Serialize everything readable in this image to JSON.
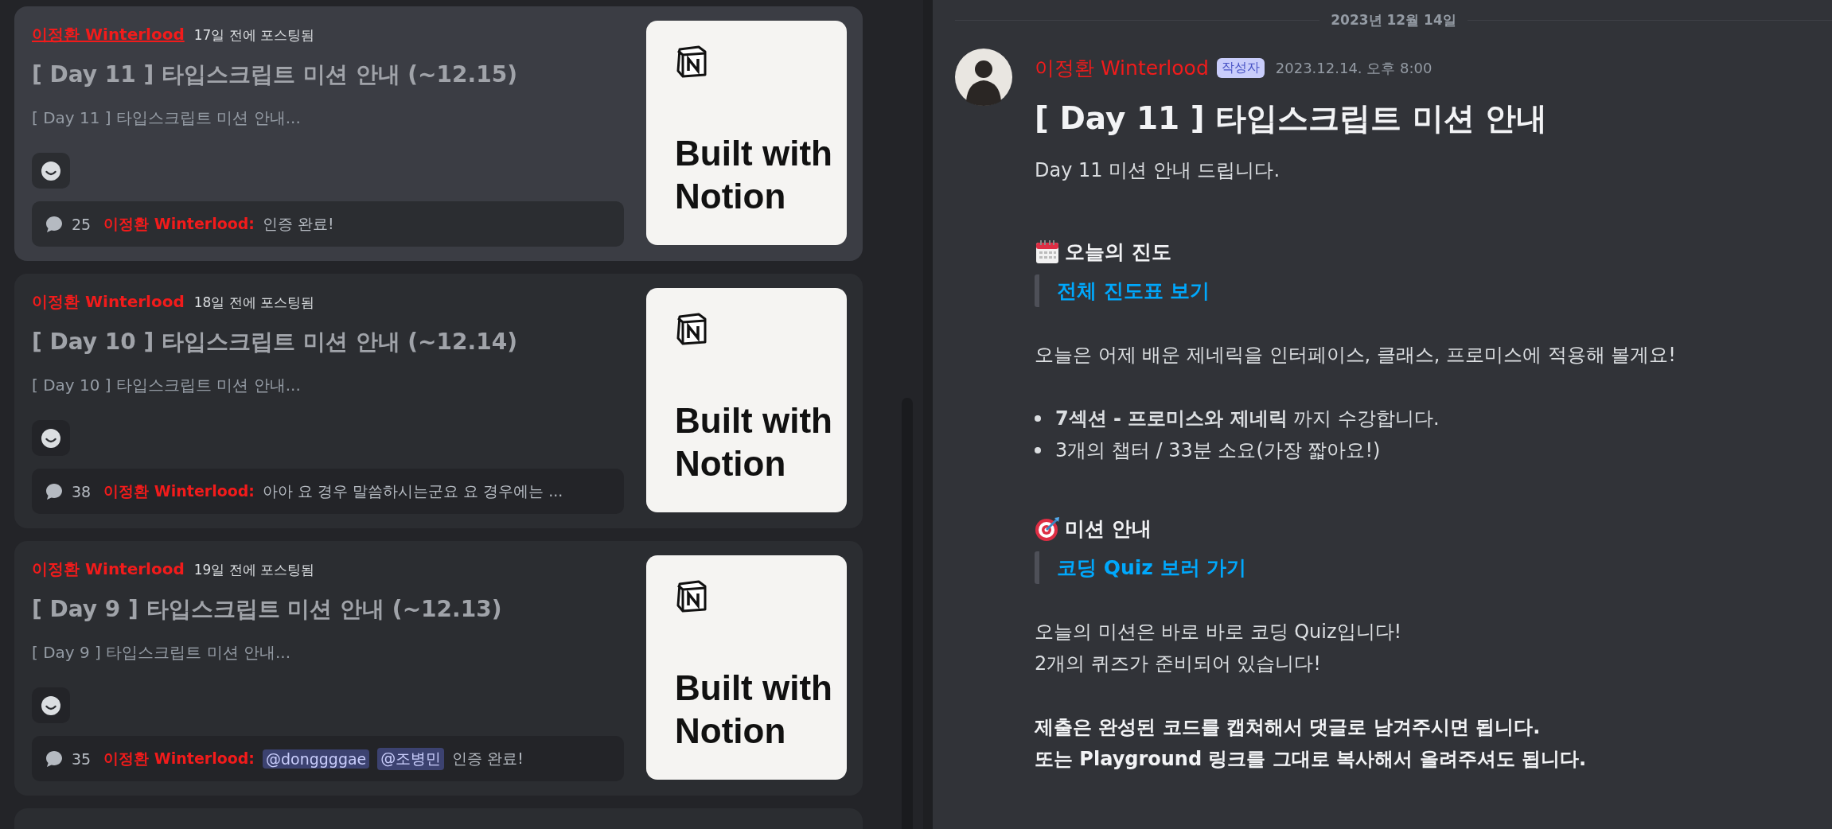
{
  "posts": [
    {
      "author": "이정환 Winterlood",
      "posted": "17일 전에 포스팅됨",
      "title": "[ Day 11 ] 타입스크립트 미션 안내 (~12.15)",
      "preview": "[ Day 11 ] 타입스크립트 미션 안내...",
      "selected": true,
      "comment_count": "25",
      "last_author": "이정환 Winterlood:",
      "last_message": [
        {
          "kind": "text",
          "text": "인증 완료!"
        }
      ],
      "thumbnail": [
        "Built with",
        "Notion"
      ]
    },
    {
      "author": "이정환 Winterlood",
      "posted": "18일 전에 포스팅됨",
      "title": "[ Day 10 ] 타입스크립트 미션 안내 (~12.14)",
      "preview": "[ Day 10 ] 타입스크립트 미션 안내...",
      "selected": false,
      "comment_count": "38",
      "last_author": "이정환 Winterlood:",
      "last_message": [
        {
          "kind": "text",
          "text": "아아 요 경우 말씀하시는군요 요 경우에는 ..."
        }
      ],
      "thumbnail": [
        "Built with",
        "Notion"
      ]
    },
    {
      "author": "이정환 Winterlood",
      "posted": "19일 전에 포스팅됨",
      "title": "[ Day 9 ] 타입스크립트 미션 안내 (~12.13)",
      "preview": "[ Day 9 ] 타입스크립트 미션 안내...",
      "selected": false,
      "comment_count": "35",
      "last_author": "이정환 Winterlood:",
      "last_message": [
        {
          "kind": "mention",
          "text": "@donggggae"
        },
        {
          "kind": "mention",
          "text": "@조병민"
        },
        {
          "kind": "text",
          "text": "인증 완료!"
        }
      ],
      "thumbnail": [
        "Built with",
        "Notion"
      ]
    }
  ],
  "post": {
    "date_divider": "2023년 12월 14일",
    "author": "이정환 Winterlood",
    "badge": "작성자",
    "timestamp": "2023.12.14. 오후 8:00",
    "title": "[ Day 11 ] 타입스크립트 미션 안내",
    "blocks": [
      {
        "kind": "paragraph",
        "bold": false,
        "lines": [
          "Day 11 미션 안내 드립니다."
        ]
      },
      {
        "kind": "heading",
        "text": "오늘의 진도"
      },
      {
        "kind": "quote",
        "link": "전체 진도표 보기"
      },
      {
        "kind": "paragraph",
        "bold": false,
        "lines": [
          "오늘은 어제 배운 제네릭을 인터페이스, 클래스, 프로미스에 적용해 볼게요!"
        ]
      },
      {
        "kind": "bullets",
        "items": [
          "**7섹션 - 프로미스와 제네릭** 까지 수강합니다.",
          "3개의 챕터 / 33분 소요(가장 짧아요!)"
        ]
      },
      {
        "kind": "heading",
        "text": "미션 안내"
      },
      {
        "kind": "quote",
        "link": "코딩 Quiz 보러 가기"
      },
      {
        "kind": "paragraph",
        "bold": false,
        "lines": [
          "오늘의 미션은 바로 바로 코딩 Quiz입니다!",
          "2개의 퀴즈가 준비되어 있습니다!"
        ]
      },
      {
        "kind": "paragraph",
        "bold": true,
        "lines": [
          "제출은 완성된 코드를 캡쳐해서 댓글로 남겨주시면 됩니다.",
          "또는 Playground 링크를 그대로 복사해서 올려주셔도 됩니다."
        ]
      }
    ]
  }
}
